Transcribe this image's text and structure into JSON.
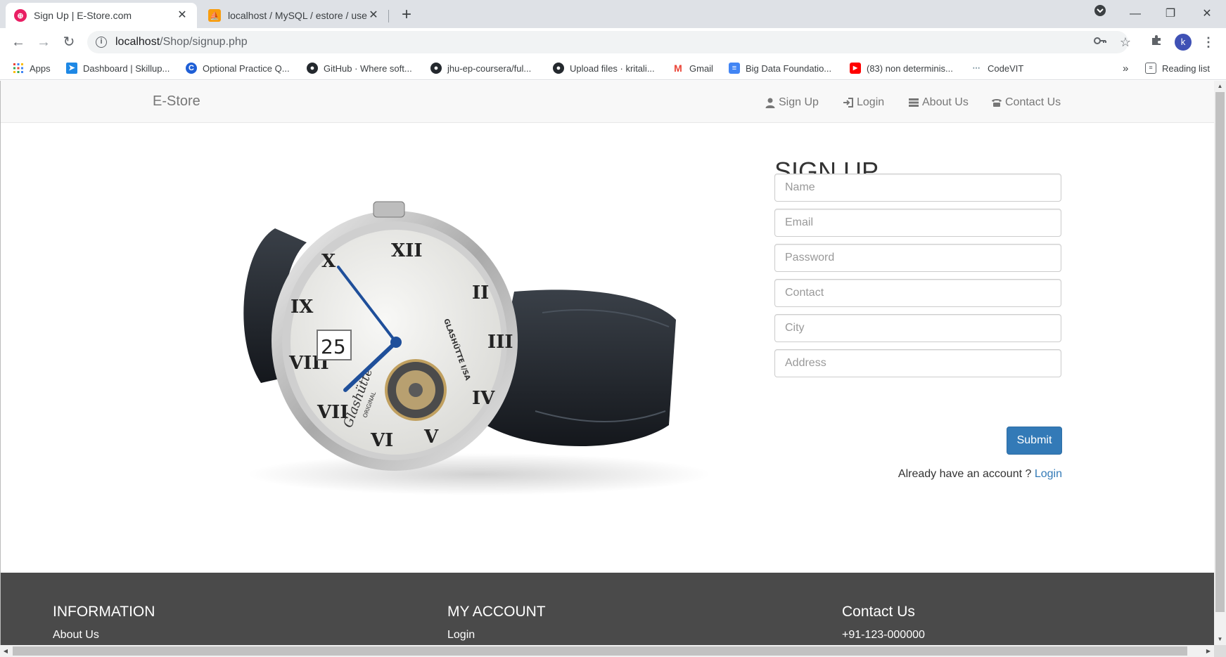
{
  "browser": {
    "tabs": [
      {
        "title": "Sign Up | E-Store.com",
        "active": true,
        "close": "✕"
      },
      {
        "title": "localhost / MySQL / estore / user",
        "active": false,
        "close": "✕"
      }
    ],
    "new_tab": "+",
    "window_controls": {
      "minimize": "—",
      "maximize": "❐",
      "close": "✕"
    },
    "url_host": "localhost",
    "url_path": "/Shop/signup.php",
    "profile_initial": "k",
    "bookmarks": [
      {
        "label": "Apps",
        "icon": "apps-grid-icon"
      },
      {
        "label": "Dashboard | Skillup...",
        "icon": "skillup-icon"
      },
      {
        "label": "Optional Practice Q...",
        "icon": "coursera-c-icon"
      },
      {
        "label": "GitHub · Where soft...",
        "icon": "github-icon"
      },
      {
        "label": "jhu-ep-coursera/ful...",
        "icon": "github-icon"
      },
      {
        "label": "Upload files · kritali...",
        "icon": "github-icon"
      },
      {
        "label": "Gmail",
        "icon": "gmail-icon"
      },
      {
        "label": "Big Data Foundatio...",
        "icon": "docs-icon"
      },
      {
        "label": "(83) non determinis...",
        "icon": "youtube-icon"
      },
      {
        "label": "CodeVIT",
        "icon": "codevit-icon"
      }
    ],
    "more_bookmarks": "»",
    "reading_list": "Reading list"
  },
  "site": {
    "brand": "E-Store",
    "nav": [
      {
        "label": "Sign Up",
        "icon": "user-icon"
      },
      {
        "label": "Login",
        "icon": "login-icon"
      },
      {
        "label": "About Us",
        "icon": "list-icon"
      },
      {
        "label": "Contact Us",
        "icon": "phone-icon"
      }
    ]
  },
  "signup": {
    "title": "SIGN UP",
    "fields": [
      {
        "placeholder": "Name"
      },
      {
        "placeholder": "Email"
      },
      {
        "placeholder": "Password"
      },
      {
        "placeholder": "Contact"
      },
      {
        "placeholder": "City"
      },
      {
        "placeholder": "Address"
      }
    ],
    "submit": "Submit",
    "already_text": "Already have an account ?",
    "login_link": "Login"
  },
  "watch_dial": {
    "date": "25",
    "brand": "Glashütte",
    "brand_sub": "ORIGINAL",
    "maker": "GLASHÜTTE I/SA"
  },
  "footer": {
    "columns": [
      {
        "heading": "INFORMATION",
        "link": "About Us"
      },
      {
        "heading": "MY ACCOUNT",
        "link": "Login"
      },
      {
        "heading": "Contact Us",
        "link": "+91-123-000000"
      }
    ]
  },
  "colors": {
    "primary": "#337ab7",
    "footer_bg": "#4a4a4a",
    "navbar_bg": "#f8f8f8"
  }
}
